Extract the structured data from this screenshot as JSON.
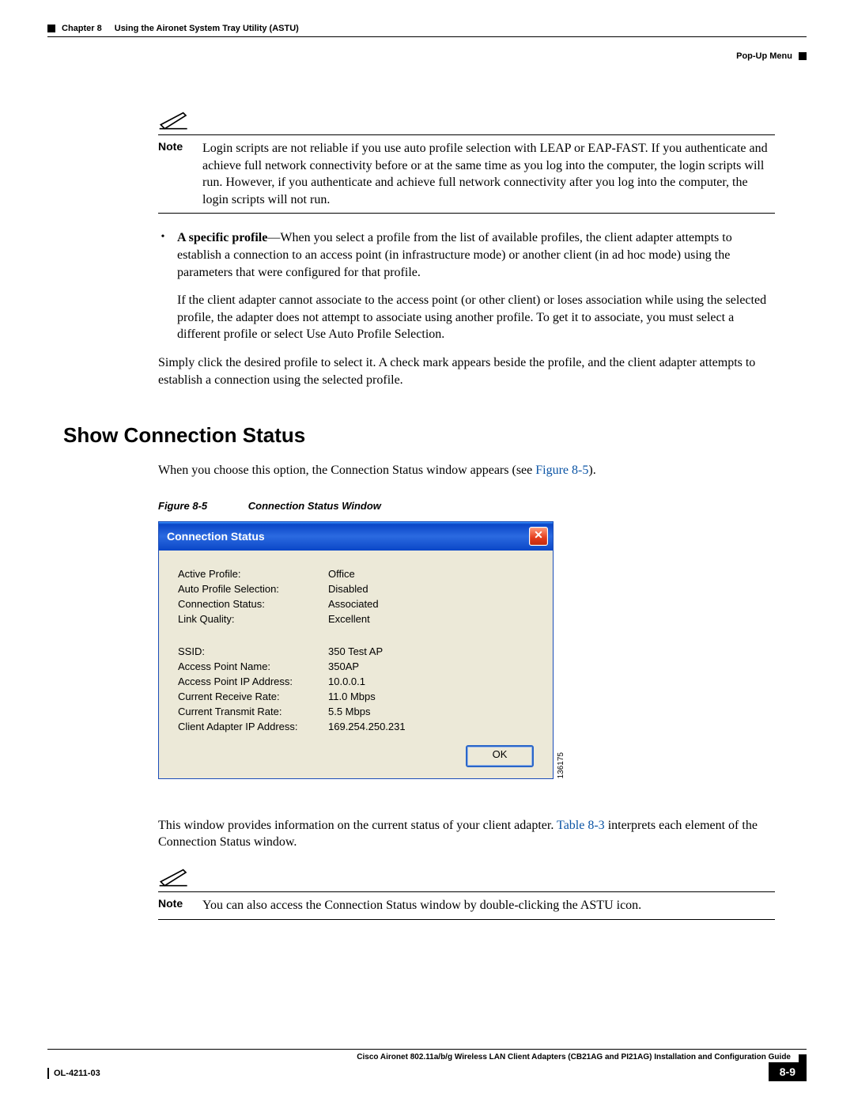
{
  "header": {
    "chapter_label": "Chapter 8",
    "chapter_title": "Using the Aironet System Tray Utility (ASTU)",
    "breadcrumb": "Pop-Up Menu"
  },
  "note1": {
    "label": "Note",
    "text": "Login scripts are not reliable if you use auto profile selection with LEAP or EAP-FAST. If you authenticate and achieve full network connectivity before or at the same time as you log into the computer, the login scripts will run. However, if you authenticate and achieve full network connectivity after you log into the computer, the login scripts will not run."
  },
  "bullet": {
    "bold": "A specific profile",
    "rest": "—When you select a profile from the list of available profiles, the client adapter attempts to establish a connection to an access point (in infrastructure mode) or another client (in ad hoc mode) using the parameters that were configured for that profile."
  },
  "bullet_para2": "If the client adapter cannot associate to the access point (or other client) or loses association while using the selected profile, the adapter does not attempt to associate using another profile. To get it to associate, you must select a different profile or select Use Auto Profile Selection.",
  "para_simpleclick": "Simply click the desired profile to select it. A check mark appears beside the profile, and the client adapter attempts to establish a connection using the selected profile.",
  "section_heading": "Show Connection Status",
  "section_intro_a": "When you choose this option, the Connection Status window appears (see ",
  "section_intro_link": "Figure 8-5",
  "section_intro_b": ").",
  "figure": {
    "label": "Figure 8-5",
    "caption": "Connection Status Window"
  },
  "dialog": {
    "title": "Connection Status",
    "close_glyph": "✕",
    "ok_label": "OK",
    "fig_number": "136175",
    "rows1": [
      {
        "k": "Active Profile:",
        "v": "Office"
      },
      {
        "k": "Auto Profile Selection:",
        "v": "Disabled"
      },
      {
        "k": "Connection Status:",
        "v": "Associated"
      },
      {
        "k": "Link Quality:",
        "v": "Excellent"
      }
    ],
    "rows2": [
      {
        "k": "SSID:",
        "v": "350 Test AP"
      },
      {
        "k": "Access Point Name:",
        "v": "350AP"
      },
      {
        "k": "Access Point IP Address:",
        "v": "10.0.0.1"
      },
      {
        "k": "Current Receive Rate:",
        "v": "11.0 Mbps"
      },
      {
        "k": "Current Transmit Rate:",
        "v": "5.5 Mbps"
      },
      {
        "k": "Client Adapter IP Address:",
        "v": "169.254.250.231"
      }
    ]
  },
  "after_dialog_a": "This window provides information on the current status of your client adapter. ",
  "after_dialog_link": "Table 8-3",
  "after_dialog_b": " interprets each element of the Connection Status window.",
  "note2": {
    "label": "Note",
    "text": "You can also access the Connection Status window by double-clicking the ASTU icon."
  },
  "footer": {
    "guide": "Cisco Aironet 802.11a/b/g Wireless LAN Client Adapters (CB21AG and PI21AG) Installation and Configuration Guide",
    "doc": "OL-4211-03",
    "page": "8-9"
  }
}
